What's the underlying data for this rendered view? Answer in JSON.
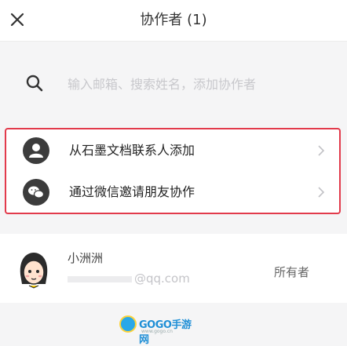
{
  "header": {
    "title": "协作者 (1)"
  },
  "search": {
    "placeholder": "输入邮箱、搜索姓名，添加协作者",
    "value": ""
  },
  "options": [
    {
      "label": "从石墨文档联系人添加",
      "icon": "contacts-icon"
    },
    {
      "label": "通过微信邀请朋友协作",
      "icon": "wechat-icon"
    }
  ],
  "member": {
    "name": "小洲洲",
    "email_domain": "@qq.com",
    "role": "所有者",
    "avatar": "cartoon-girl-avatar"
  },
  "watermark": {
    "text": "GOGO手游网",
    "sub": "www.gogo.cn"
  },
  "colors": {
    "highlight": "#e23a4b",
    "icon_dark": "#3c3c3c",
    "background": "#f5f5f6"
  }
}
